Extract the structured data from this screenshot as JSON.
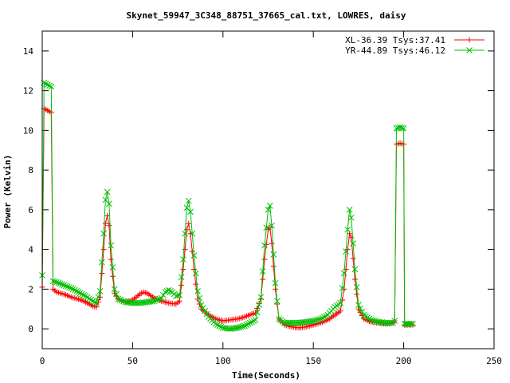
{
  "chart_data": {
    "type": "line",
    "title": "Skynet_59947_3C348_88751_37665_cal.txt, LOWRES, daisy",
    "xlabel": "Time(Seconds)",
    "ylabel": "Power (Kelvin)",
    "xlim": [
      0,
      250
    ],
    "ylim": [
      -1,
      15
    ],
    "xticks": [
      "0",
      "50",
      "100",
      "150",
      "200",
      "250"
    ],
    "yticks": [
      "0",
      "2",
      "4",
      "6",
      "8",
      "10",
      "12",
      "14"
    ],
    "grid": false,
    "legend_position": "top-right",
    "series": [
      {
        "name": "XL-36.39 Tsys:37.41",
        "color": "#ff0000",
        "marker": "plus",
        "points": [
          [
            0,
            2.1
          ],
          [
            1,
            11.1
          ],
          [
            3,
            11.0
          ],
          [
            5,
            10.9
          ],
          [
            6,
            2.0
          ],
          [
            8,
            1.85
          ],
          [
            12,
            1.75
          ],
          [
            16,
            1.6
          ],
          [
            20,
            1.5
          ],
          [
            24,
            1.35
          ],
          [
            28,
            1.15
          ],
          [
            30,
            1.1
          ],
          [
            32,
            1.6
          ],
          [
            34,
            4.0
          ],
          [
            35,
            5.3
          ],
          [
            36,
            5.7
          ],
          [
            37,
            5.2
          ],
          [
            38,
            3.5
          ],
          [
            40,
            1.8
          ],
          [
            42,
            1.5
          ],
          [
            46,
            1.35
          ],
          [
            50,
            1.45
          ],
          [
            54,
            1.75
          ],
          [
            56,
            1.85
          ],
          [
            58,
            1.8
          ],
          [
            62,
            1.55
          ],
          [
            66,
            1.4
          ],
          [
            70,
            1.3
          ],
          [
            74,
            1.25
          ],
          [
            76,
            1.4
          ],
          [
            78,
            3.0
          ],
          [
            80,
            5.0
          ],
          [
            81,
            5.3
          ],
          [
            82,
            4.8
          ],
          [
            84,
            3.0
          ],
          [
            86,
            1.5
          ],
          [
            88,
            1.0
          ],
          [
            92,
            0.7
          ],
          [
            96,
            0.5
          ],
          [
            100,
            0.4
          ],
          [
            104,
            0.45
          ],
          [
            108,
            0.5
          ],
          [
            112,
            0.6
          ],
          [
            116,
            0.75
          ],
          [
            118,
            0.8
          ],
          [
            121,
            1.5
          ],
          [
            123,
            3.5
          ],
          [
            125,
            5.0
          ],
          [
            126,
            5.1
          ],
          [
            127,
            4.3
          ],
          [
            129,
            2.0
          ],
          [
            131,
            0.5
          ],
          [
            134,
            0.2
          ],
          [
            138,
            0.1
          ],
          [
            142,
            0.05
          ],
          [
            146,
            0.1
          ],
          [
            150,
            0.2
          ],
          [
            154,
            0.3
          ],
          [
            158,
            0.45
          ],
          [
            162,
            0.7
          ],
          [
            165,
            0.9
          ],
          [
            167,
            2.0
          ],
          [
            169,
            4.0
          ],
          [
            170,
            4.8
          ],
          [
            171,
            4.6
          ],
          [
            173,
            2.5
          ],
          [
            175,
            1.0
          ],
          [
            178,
            0.5
          ],
          [
            182,
            0.35
          ],
          [
            186,
            0.3
          ],
          [
            190,
            0.25
          ],
          [
            194,
            0.3
          ],
          [
            195,
            0.4
          ],
          [
            196,
            9.3
          ],
          [
            198,
            9.35
          ],
          [
            200,
            9.3
          ],
          [
            200.5,
            0.2
          ],
          [
            202,
            0.2
          ],
          [
            205,
            0.2
          ]
        ]
      },
      {
        "name": "YR-44.89 Tsys:46.12",
        "color": "#00c000",
        "marker": "cross",
        "points": [
          [
            0,
            2.7
          ],
          [
            1,
            12.4
          ],
          [
            3,
            12.3
          ],
          [
            5,
            12.2
          ],
          [
            6,
            2.4
          ],
          [
            8,
            2.35
          ],
          [
            12,
            2.2
          ],
          [
            16,
            2.05
          ],
          [
            20,
            1.85
          ],
          [
            24,
            1.65
          ],
          [
            28,
            1.4
          ],
          [
            30,
            1.3
          ],
          [
            32,
            1.9
          ],
          [
            34,
            4.8
          ],
          [
            35,
            6.5
          ],
          [
            36,
            6.9
          ],
          [
            37,
            6.3
          ],
          [
            38,
            4.2
          ],
          [
            40,
            2.0
          ],
          [
            42,
            1.5
          ],
          [
            46,
            1.35
          ],
          [
            50,
            1.3
          ],
          [
            54,
            1.3
          ],
          [
            58,
            1.35
          ],
          [
            62,
            1.4
          ],
          [
            66,
            1.55
          ],
          [
            68,
            1.85
          ],
          [
            70,
            1.95
          ],
          [
            72,
            1.85
          ],
          [
            74,
            1.65
          ],
          [
            76,
            1.7
          ],
          [
            78,
            3.5
          ],
          [
            80,
            6.1
          ],
          [
            81,
            6.45
          ],
          [
            82,
            5.9
          ],
          [
            84,
            3.7
          ],
          [
            86,
            1.9
          ],
          [
            88,
            1.2
          ],
          [
            92,
            0.6
          ],
          [
            96,
            0.25
          ],
          [
            100,
            0.05
          ],
          [
            104,
            0.0
          ],
          [
            108,
            0.05
          ],
          [
            112,
            0.15
          ],
          [
            116,
            0.35
          ],
          [
            118,
            0.45
          ],
          [
            121,
            1.6
          ],
          [
            123,
            4.2
          ],
          [
            125,
            6.0
          ],
          [
            126,
            6.2
          ],
          [
            127,
            5.2
          ],
          [
            129,
            2.3
          ],
          [
            131,
            0.5
          ],
          [
            134,
            0.3
          ],
          [
            138,
            0.3
          ],
          [
            142,
            0.3
          ],
          [
            146,
            0.35
          ],
          [
            150,
            0.4
          ],
          [
            154,
            0.5
          ],
          [
            158,
            0.7
          ],
          [
            162,
            1.1
          ],
          [
            165,
            1.3
          ],
          [
            167,
            2.8
          ],
          [
            169,
            5.0
          ],
          [
            170,
            6.0
          ],
          [
            171,
            5.6
          ],
          [
            173,
            3.0
          ],
          [
            175,
            1.2
          ],
          [
            178,
            0.7
          ],
          [
            182,
            0.45
          ],
          [
            186,
            0.35
          ],
          [
            190,
            0.3
          ],
          [
            194,
            0.3
          ],
          [
            195,
            0.4
          ],
          [
            196,
            10.1
          ],
          [
            198,
            10.15
          ],
          [
            200,
            10.1
          ],
          [
            200.5,
            0.25
          ],
          [
            202,
            0.25
          ],
          [
            205,
            0.25
          ]
        ]
      }
    ]
  }
}
